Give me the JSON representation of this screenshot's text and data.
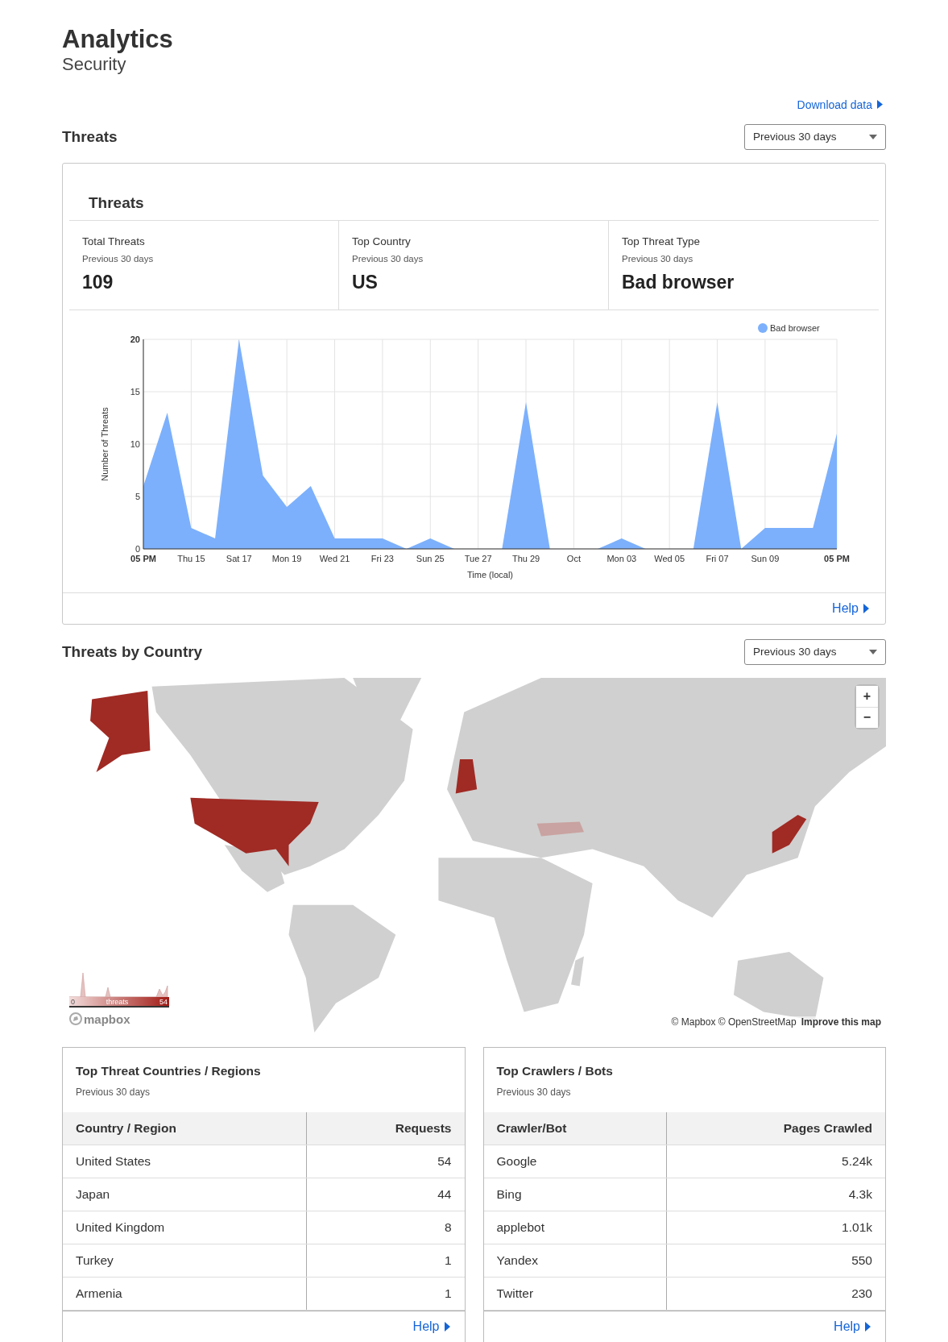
{
  "header": {
    "title": "Analytics",
    "subtitle": "Security"
  },
  "download_link": "Download data",
  "threats_section": {
    "title": "Threats",
    "range_select": "Previous 30 days",
    "card": {
      "title": "Threats",
      "stats": [
        {
          "label": "Total Threats",
          "period": "Previous 30 days",
          "value": "109"
        },
        {
          "label": "Top Country",
          "period": "Previous 30 days",
          "value": "US"
        },
        {
          "label": "Top Threat Type",
          "period": "Previous 30 days",
          "value": "Bad browser"
        }
      ],
      "chart_data": {
        "type": "area",
        "xlabel": "Time (local)",
        "ylabel": "Number of Threats",
        "categories": [
          "05 PM",
          null,
          "Thu 15",
          null,
          "Sat 17",
          null,
          "Mon 19",
          null,
          "Wed 21",
          null,
          "Fri 23",
          null,
          "Sun 25",
          null,
          "Tue 27",
          null,
          "Thu 29",
          null,
          "Oct",
          null,
          "Mon 03",
          null,
          "Wed 05",
          null,
          "Fri 07",
          null,
          "Sun 09",
          null,
          null,
          "05 PM"
        ],
        "series": [
          {
            "name": "Bad browser",
            "color": "#7cb0fc",
            "values": [
              6,
              13,
              2,
              1,
              20,
              7,
              4,
              6,
              1,
              1,
              1,
              0,
              1,
              0,
              0,
              0,
              14,
              0,
              0,
              0,
              1,
              0,
              0,
              0,
              14,
              0,
              2,
              2,
              2,
              11
            ]
          }
        ],
        "ylim": [
          0,
          20
        ],
        "yticks": [
          0,
          5,
          10,
          15,
          20
        ],
        "grid": true
      },
      "help_link": "Help"
    }
  },
  "country_section": {
    "title": "Threats by Country",
    "range_select": "Previous 30 days",
    "map": {
      "zoom_in": "+",
      "zoom_out": "−",
      "legend": {
        "min": "0",
        "label": "threats",
        "max": "54"
      },
      "logo": "mapbox",
      "attribution": "© Mapbox © OpenStreetMap",
      "improve_link": "Improve this map"
    }
  },
  "tables": [
    {
      "title": "Top Threat Countries / Regions",
      "period": "Previous 30 days",
      "columns": [
        "Country / Region",
        "Requests"
      ],
      "rows": [
        [
          "United States",
          "54"
        ],
        [
          "Japan",
          "44"
        ],
        [
          "United Kingdom",
          "8"
        ],
        [
          "Turkey",
          "1"
        ],
        [
          "Armenia",
          "1"
        ]
      ],
      "help_link": "Help"
    },
    {
      "title": "Top Crawlers / Bots",
      "period": "Previous 30 days",
      "columns": [
        "Crawler/Bot",
        "Pages Crawled"
      ],
      "rows": [
        [
          "Google",
          "5.24k"
        ],
        [
          "Bing",
          "4.3k"
        ],
        [
          "applebot",
          "1.01k"
        ],
        [
          "Yandex",
          "550"
        ],
        [
          "Twitter",
          "230"
        ]
      ],
      "help_link": "Help"
    }
  ]
}
